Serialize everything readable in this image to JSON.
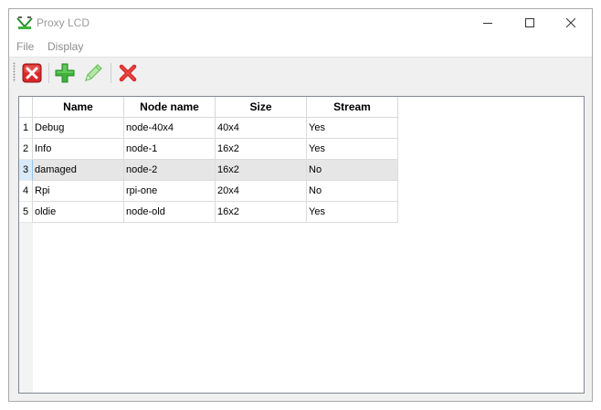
{
  "window": {
    "title": "Proxy LCD",
    "title_color": "#9a9a9a"
  },
  "menu": {
    "items": [
      {
        "label": "File"
      },
      {
        "label": "Display"
      }
    ]
  },
  "toolbar": {
    "buttons": [
      {
        "icon": "close-red-square-icon"
      },
      {
        "icon": "add-green-plus-icon"
      },
      {
        "icon": "edit-pencil-icon"
      },
      {
        "icon": "delete-red-x-icon"
      }
    ]
  },
  "table": {
    "columns": [
      "Name",
      "Node name",
      "Size",
      "Stream"
    ],
    "rows": [
      {
        "num": "1",
        "cells": [
          "Debug",
          "node-40x4",
          "40x4",
          "Yes"
        ]
      },
      {
        "num": "2",
        "cells": [
          "Info",
          "node-1",
          "16x2",
          "Yes"
        ]
      },
      {
        "num": "3",
        "cells": [
          "damaged",
          "node-2",
          "16x2",
          "No"
        ]
      },
      {
        "num": "4",
        "cells": [
          "Rpi",
          "rpi-one",
          "20x4",
          "No"
        ]
      },
      {
        "num": "5",
        "cells": [
          "oldie",
          "node-old",
          "16x2",
          "Yes"
        ]
      }
    ],
    "selected_row": 3
  },
  "colors": {
    "red": "#d9282a",
    "green": "#3db33a",
    "selection_header": "#d9ebf9",
    "selection_row": "#e6e6e6"
  }
}
